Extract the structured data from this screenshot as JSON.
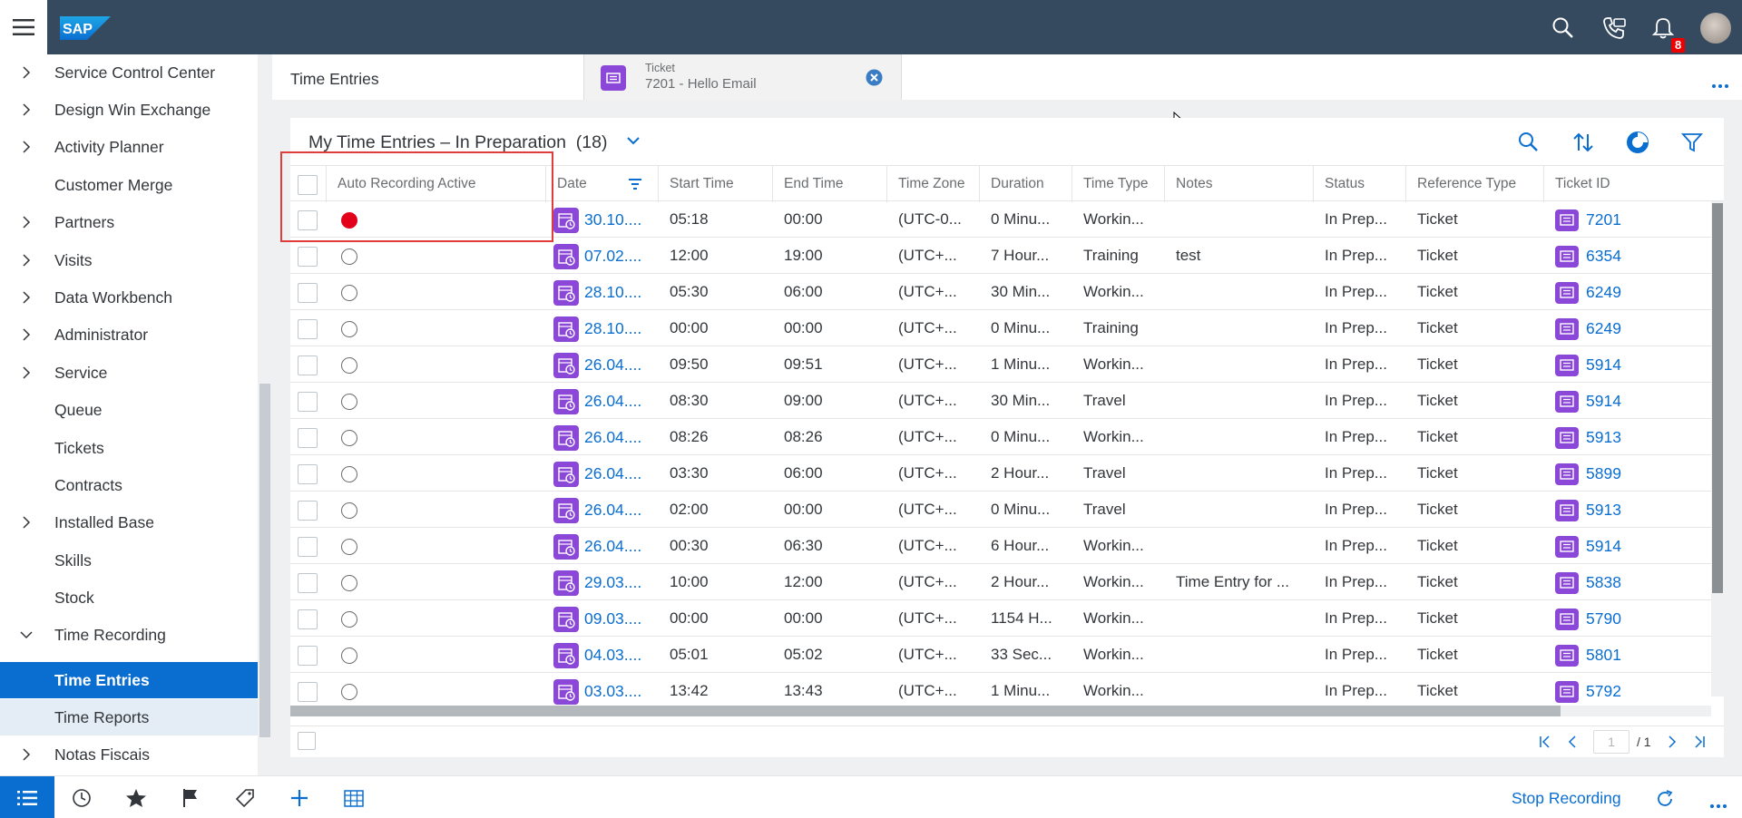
{
  "shell": {
    "logo_text": "SAP",
    "notification_count": "8",
    "icons": [
      "menu-icon",
      "search-icon",
      "contact-support-icon",
      "notifications-icon"
    ]
  },
  "sidebar": {
    "items": [
      {
        "label": "Service Control Center",
        "expandable": true
      },
      {
        "label": "Design Win Exchange",
        "expandable": true
      },
      {
        "label": "Activity Planner",
        "expandable": true
      },
      {
        "label": "Customer Merge",
        "expandable": false
      },
      {
        "label": "Partners",
        "expandable": true
      },
      {
        "label": "Visits",
        "expandable": true
      },
      {
        "label": "Data Workbench",
        "expandable": true
      },
      {
        "label": "Administrator",
        "expandable": true
      },
      {
        "label": "Service",
        "expandable": true
      },
      {
        "label": "Queue",
        "expandable": false
      },
      {
        "label": "Tickets",
        "expandable": false
      },
      {
        "label": "Contracts",
        "expandable": false
      },
      {
        "label": "Installed Base",
        "expandable": true
      },
      {
        "label": "Skills",
        "expandable": false
      },
      {
        "label": "Stock",
        "expandable": false
      },
      {
        "label": "Time Recording",
        "expandable": true,
        "expanded": true
      },
      {
        "label": "Time Entries",
        "active": true
      },
      {
        "label": "Time Reports",
        "selected_light": true
      },
      {
        "label": "Notas Fiscais",
        "expandable": true
      }
    ]
  },
  "tabs": {
    "tab1_label": "Time Entries",
    "tab2_sub": "Ticket",
    "tab2_main": "7201 - Hello Email"
  },
  "panel": {
    "title": "My Time Entries – In Preparation",
    "count": "(18)",
    "columns": [
      "Auto Recording Active",
      "Date",
      "Start Time",
      "End Time",
      "Time Zone",
      "Duration",
      "Time Type",
      "Notes",
      "Status",
      "Reference Type",
      "Ticket ID"
    ],
    "rows": [
      {
        "rec": true,
        "date": "30.10....",
        "start": "05:18",
        "end": "00:00",
        "tz": "(UTC-0...",
        "dur": "0 Minu...",
        "type": "Workin...",
        "notes": "",
        "status": "In Prep...",
        "ref": "Ticket",
        "ticket": "7201"
      },
      {
        "rec": false,
        "date": "07.02....",
        "start": "12:00",
        "end": "19:00",
        "tz": "(UTC+...",
        "dur": "7 Hour...",
        "type": "Training",
        "notes": "test",
        "status": "In Prep...",
        "ref": "Ticket",
        "ticket": "6354"
      },
      {
        "rec": false,
        "date": "28.10....",
        "start": "05:30",
        "end": "06:00",
        "tz": "(UTC+...",
        "dur": "30 Min...",
        "type": "Workin...",
        "notes": "",
        "status": "In Prep...",
        "ref": "Ticket",
        "ticket": "6249"
      },
      {
        "rec": false,
        "date": "28.10....",
        "start": "00:00",
        "end": "00:00",
        "tz": "(UTC+...",
        "dur": "0 Minu...",
        "type": "Training",
        "notes": "",
        "status": "In Prep...",
        "ref": "Ticket",
        "ticket": "6249"
      },
      {
        "rec": false,
        "date": "26.04....",
        "start": "09:50",
        "end": "09:51",
        "tz": "(UTC+...",
        "dur": "1 Minu...",
        "type": "Workin...",
        "notes": "",
        "status": "In Prep...",
        "ref": "Ticket",
        "ticket": "5914"
      },
      {
        "rec": false,
        "date": "26.04....",
        "start": "08:30",
        "end": "09:00",
        "tz": "(UTC+...",
        "dur": "30 Min...",
        "type": "Travel",
        "notes": "",
        "status": "In Prep...",
        "ref": "Ticket",
        "ticket": "5914"
      },
      {
        "rec": false,
        "date": "26.04....",
        "start": "08:26",
        "end": "08:26",
        "tz": "(UTC+...",
        "dur": "0 Minu...",
        "type": "Workin...",
        "notes": "",
        "status": "In Prep...",
        "ref": "Ticket",
        "ticket": "5913"
      },
      {
        "rec": false,
        "date": "26.04....",
        "start": "03:30",
        "end": "06:00",
        "tz": "(UTC+...",
        "dur": "2 Hour...",
        "type": "Travel",
        "notes": "",
        "status": "In Prep...",
        "ref": "Ticket",
        "ticket": "5899"
      },
      {
        "rec": false,
        "date": "26.04....",
        "start": "02:00",
        "end": "00:00",
        "tz": "(UTC+...",
        "dur": "0 Minu...",
        "type": "Travel",
        "notes": "",
        "status": "In Prep...",
        "ref": "Ticket",
        "ticket": "5913"
      },
      {
        "rec": false,
        "date": "26.04....",
        "start": "00:30",
        "end": "06:30",
        "tz": "(UTC+...",
        "dur": "6 Hour...",
        "type": "Workin...",
        "notes": "",
        "status": "In Prep...",
        "ref": "Ticket",
        "ticket": "5914"
      },
      {
        "rec": false,
        "date": "29.03....",
        "start": "10:00",
        "end": "12:00",
        "tz": "(UTC+...",
        "dur": "2 Hour...",
        "type": "Workin...",
        "notes": "Time Entry for ...",
        "status": "In Prep...",
        "ref": "Ticket",
        "ticket": "5838"
      },
      {
        "rec": false,
        "date": "09.03....",
        "start": "00:00",
        "end": "00:00",
        "tz": "(UTC+...",
        "dur": "1154 H...",
        "type": "Workin...",
        "notes": "",
        "status": "In Prep...",
        "ref": "Ticket",
        "ticket": "5790"
      },
      {
        "rec": false,
        "date": "04.03....",
        "start": "05:01",
        "end": "05:02",
        "tz": "(UTC+...",
        "dur": "33 Sec...",
        "type": "Workin...",
        "notes": "",
        "status": "In Prep...",
        "ref": "Ticket",
        "ticket": "5801"
      },
      {
        "rec": false,
        "date": "03.03....",
        "start": "13:42",
        "end": "13:43",
        "tz": "(UTC+...",
        "dur": "1 Minu...",
        "type": "Workin...",
        "notes": "",
        "status": "In Prep...",
        "ref": "Ticket",
        "ticket": "5792"
      }
    ],
    "pager": {
      "page": "1",
      "total": "/ 1"
    }
  },
  "bottom": {
    "stop_recording": "Stop Recording"
  }
}
